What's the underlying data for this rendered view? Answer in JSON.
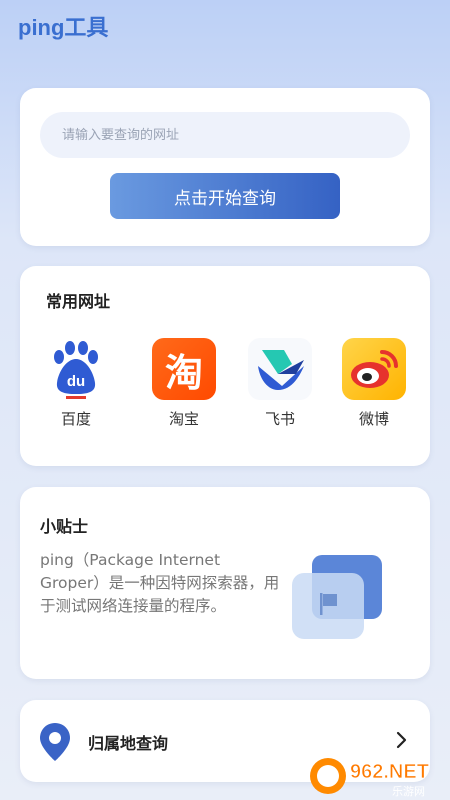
{
  "header": {
    "title": "ping工具"
  },
  "search": {
    "placeholder": "请输入要查询的网址",
    "value": "",
    "button_label": "点击开始查询"
  },
  "common_sites": {
    "title": "常用网址",
    "items": [
      {
        "label": "百度",
        "icon": "baidu-icon",
        "glyph": "du"
      },
      {
        "label": "淘宝",
        "icon": "taobao-icon",
        "glyph": "淘"
      },
      {
        "label": "飞书",
        "icon": "feishu-icon"
      },
      {
        "label": "微博",
        "icon": "weibo-icon"
      }
    ]
  },
  "tips": {
    "title": "小贴士",
    "text": "ping（Package Internet Groper）是一种因特网探索器，用于测试网络连接量的程序。"
  },
  "location": {
    "label": "归属地查询",
    "icon": "location-pin-icon"
  },
  "watermark": {
    "text": "962.NET",
    "subtext": "乐游网"
  },
  "colors": {
    "accent": "#3a6fd0",
    "button_start": "#6a9ae0",
    "button_end": "#3562c4",
    "taobao": "#ff5000",
    "weibo": "#ffc107"
  }
}
